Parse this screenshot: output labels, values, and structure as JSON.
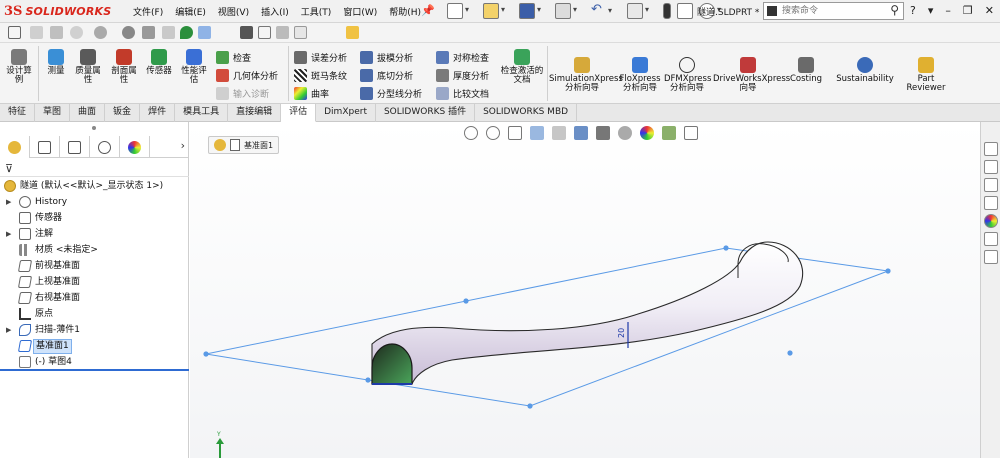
{
  "titlebar": {
    "logo_ds": "3S",
    "logo_text": "SOLIDWORKS",
    "menu": [
      "文件(F)",
      "编辑(E)",
      "视图(V)",
      "插入(I)",
      "工具(T)",
      "窗口(W)",
      "帮助(H)"
    ],
    "filename": "隧道.SLDPRT *",
    "search_placeholder": "搜索命令",
    "controls": [
      "?",
      "-",
      "–",
      "❐",
      "✕"
    ]
  },
  "ribbon": {
    "big_buttons": [
      {
        "label": "设计算例",
        "icon": "design-study-icon",
        "color": "#7a7a7a"
      },
      {
        "label": "测量",
        "icon": "measure-icon",
        "color": "#3a8fd6"
      },
      {
        "label": "质量属性",
        "icon": "mass-properties-icon",
        "color": "#5a5a5a"
      },
      {
        "label": "剖面属性",
        "icon": "section-properties-icon",
        "color": "#c23b2a"
      },
      {
        "label": "传感器",
        "icon": "sensor-icon",
        "color": "#2f9a4a"
      },
      {
        "label": "性能评估",
        "icon": "performance-evaluation-icon",
        "color": "#3a6fd6"
      }
    ],
    "col1": [
      {
        "label": "检查",
        "icon": "check-icon"
      },
      {
        "label": "几何体分析",
        "icon": "geometry-analysis-icon"
      },
      {
        "label": "输入诊断",
        "icon": "import-diagnostics-icon",
        "disabled": true
      }
    ],
    "col2": [
      {
        "label": "误差分析",
        "icon": "deviation-analysis-icon"
      },
      {
        "label": "斑马条纹",
        "icon": "zebra-stripes-icon"
      },
      {
        "label": "曲率",
        "icon": "curvature-icon"
      }
    ],
    "col3": [
      {
        "label": "拔模分析",
        "icon": "draft-analysis-icon"
      },
      {
        "label": "底切分析",
        "icon": "undercut-analysis-icon"
      },
      {
        "label": "分型线分析",
        "icon": "parting-line-analysis-icon"
      }
    ],
    "col4": [
      {
        "label": "对称检查",
        "icon": "symmetry-check-icon"
      },
      {
        "label": "厚度分析",
        "icon": "thickness-analysis-icon"
      },
      {
        "label": "比较文档",
        "icon": "compare-documents-icon"
      }
    ],
    "check_active": "检查激活的文档",
    "xpress": [
      {
        "label": "SimulationXpress 分析向导",
        "icon": "simulationxpress-icon"
      },
      {
        "label": "FloXpress 分析向导",
        "icon": "floxpress-icon"
      },
      {
        "label": "DFMXpress 分析向导",
        "icon": "dfmxpress-icon"
      },
      {
        "label": "DriveWorksXpress 向导",
        "icon": "driveworksxpress-icon"
      },
      {
        "label": "Costing",
        "icon": "costing-icon"
      },
      {
        "label": "Sustainability",
        "icon": "sustainability-icon"
      },
      {
        "label": "Part Reviewer",
        "icon": "part-reviewer-icon"
      }
    ]
  },
  "tabs": [
    "特征",
    "草图",
    "曲面",
    "钣金",
    "焊件",
    "模具工具",
    "直接编辑",
    "评估",
    "DimXpert",
    "SOLIDWORKS 插件",
    "SOLIDWORKS MBD"
  ],
  "active_tab": "评估",
  "tree": {
    "root": "隧道 (默认<<默认>_显示状态 1>)",
    "items": [
      {
        "label": "History",
        "icon": "history-icon",
        "arrow": true
      },
      {
        "label": "传感器",
        "icon": "sensors-icon",
        "arrow": false
      },
      {
        "label": "注解",
        "icon": "annotations-icon",
        "arrow": true
      },
      {
        "label": "材质 <未指定>",
        "icon": "material-icon",
        "arrow": false
      },
      {
        "label": "前视基准面",
        "icon": "plane-icon",
        "arrow": false
      },
      {
        "label": "上视基准面",
        "icon": "plane-icon",
        "arrow": false
      },
      {
        "label": "右视基准面",
        "icon": "plane-icon",
        "arrow": false
      },
      {
        "label": "原点",
        "icon": "origin-icon",
        "arrow": false
      },
      {
        "label": "扫描-薄件1",
        "icon": "sweep-thin-icon",
        "arrow": true
      },
      {
        "label": "基准面1",
        "icon": "plane-icon",
        "arrow": false,
        "selected": true
      },
      {
        "label": "(-) 草图4",
        "icon": "sketch-icon",
        "arrow": false
      }
    ]
  },
  "viewport": {
    "breadcrumb": "基准面1",
    "dimension": "20"
  }
}
